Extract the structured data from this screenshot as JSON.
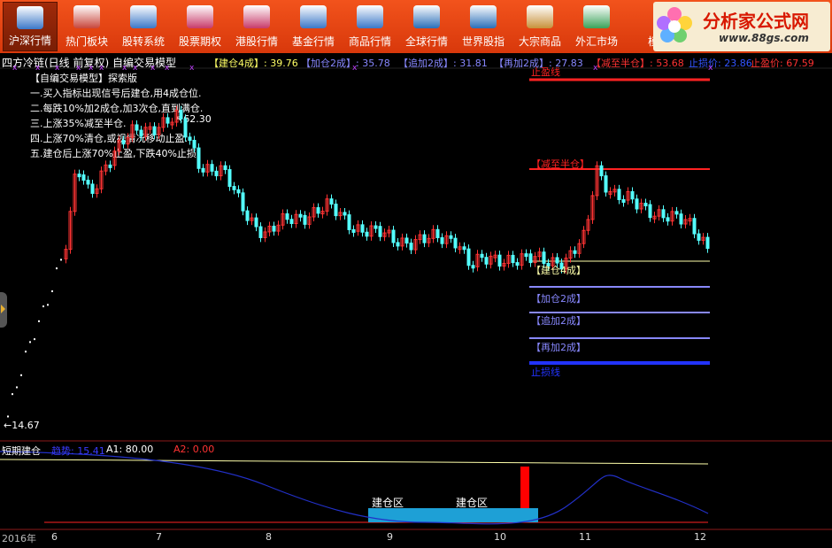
{
  "toolbar": {
    "items": [
      {
        "label": "沪深行情",
        "icon": "chart-icon",
        "color": "#3b78c8",
        "active": true
      },
      {
        "label": "热门板块",
        "icon": "fire-icon",
        "color": "#c8463b",
        "active": false
      },
      {
        "label": "股转系统",
        "icon": "chart-icon",
        "color": "#3b78c8",
        "active": false
      },
      {
        "label": "股票期权",
        "icon": "chart-icon",
        "color": "#c83b6a",
        "active": false
      },
      {
        "label": "港股行情",
        "icon": "chart-icon",
        "color": "#c83b6a",
        "active": false
      },
      {
        "label": "基金行情",
        "icon": "coins-icon",
        "color": "#3b78c8",
        "active": false
      },
      {
        "label": "商品行情",
        "icon": "package-icon",
        "color": "#3b78c8",
        "active": false
      },
      {
        "label": "全球行情",
        "icon": "globe-icon",
        "color": "#2a6fb8",
        "active": false
      },
      {
        "label": "世界股指",
        "icon": "globe-icon",
        "color": "#2a6fb8",
        "active": false
      },
      {
        "label": "大宗商品",
        "icon": "crate-icon",
        "color": "#c8923b",
        "active": false
      },
      {
        "label": "外汇市场",
        "icon": "currency-icon",
        "color": "#3ba35a",
        "active": false
      },
      {
        "label": "模",
        "icon": "",
        "color": "#d8380b",
        "active": false
      }
    ]
  },
  "logo": {
    "title": "分析家公式网",
    "url": "www.88gs.com"
  },
  "header": {
    "title": "四方冷链(日线 前复权) 自编交易模型",
    "indicators": [
      {
        "text": "【建仓4成】: 39.76",
        "color": "#ffff66"
      },
      {
        "text": "【加仓2成】: 35.78",
        "color": "#8888ff"
      },
      {
        "text": "【追加2成】: 31.81",
        "color": "#8888ff"
      },
      {
        "text": "【再加2成】: 27.83",
        "color": "#8888ff"
      },
      {
        "text": "【减至半仓】: 53.68",
        "color": "#ff3333"
      },
      {
        "text": "止损价: 23.86",
        "color": "#3355ff"
      },
      {
        "text": "止盈价: 67.59",
        "color": "#ff3333"
      }
    ]
  },
  "strategy": [
    "【自编交易模型】探索版",
    "一.买入指标出现信号后建仓,用4成仓位.",
    "二.每跌10%加2成仓,加3次仓,直到满仓.",
    "三.上涨35%减至半仓.",
    "四.上涨70%清仓,或视情况移动止盈.",
    "五.建仓后上涨70%止盈,下跌40%止损!"
  ],
  "annotations": {
    "high": "62.30",
    "low": "14.67"
  },
  "levels": [
    {
      "label": "止盈线",
      "color": "#ff2222"
    },
    {
      "label": "【减至半仓】",
      "color": "#ff2222"
    },
    {
      "label": "【建仓4成】",
      "color": "#ffffaa"
    },
    {
      "label": "【加仓2成】",
      "color": "#8888ff"
    },
    {
      "label": "【追加2成】",
      "color": "#8888ff"
    },
    {
      "label": "【再加2成】",
      "color": "#8888ff"
    },
    {
      "label": "止损线",
      "color": "#2233ff"
    }
  ],
  "sub": {
    "name": "短期建仓",
    "trend": "趋势: 15.41",
    "a1": "A1: 80.00",
    "a2": "A2: 0.00",
    "zone_labels": [
      "建仓区",
      "建仓区"
    ]
  },
  "axis": {
    "year": "2016年",
    "months": [
      "6",
      "7",
      "8",
      "9",
      "10",
      "11",
      "12"
    ]
  },
  "colors": {
    "up": "#ff3333",
    "down": "#54ffff",
    "toolbar": "#e64a16",
    "bg": "#000000"
  }
}
